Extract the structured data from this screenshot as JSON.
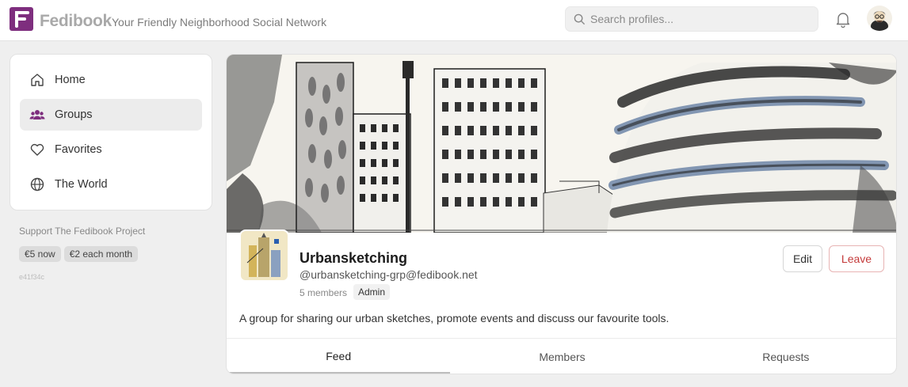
{
  "brand": {
    "name": "Fedibook",
    "tagline": "Your Friendly Neighborhood Social Network",
    "accent": "#7e2e7e"
  },
  "search": {
    "placeholder": "Search profiles..."
  },
  "sidebar": {
    "items": [
      {
        "label": "Home",
        "icon": "home-icon"
      },
      {
        "label": "Groups",
        "icon": "users-icon",
        "active": true
      },
      {
        "label": "Favorites",
        "icon": "heart-icon"
      },
      {
        "label": "The World",
        "icon": "globe-icon"
      }
    ],
    "support_label": "Support The Fedibook Project",
    "donations": [
      "€5 now",
      "€2 each month"
    ],
    "build_hash": "e41f34c"
  },
  "group": {
    "name": "Urbansketching",
    "handle": "@urbansketching-grp@fedibook.net",
    "members": "5 members",
    "role_badge": "Admin",
    "description": "A group for sharing our urban sketches, promote events and discuss our favourite tools.",
    "edit_label": "Edit",
    "leave_label": "Leave",
    "leave_color": "#c43a3a"
  },
  "tabs": [
    {
      "label": "Feed",
      "active": true
    },
    {
      "label": "Members"
    },
    {
      "label": "Requests"
    }
  ]
}
